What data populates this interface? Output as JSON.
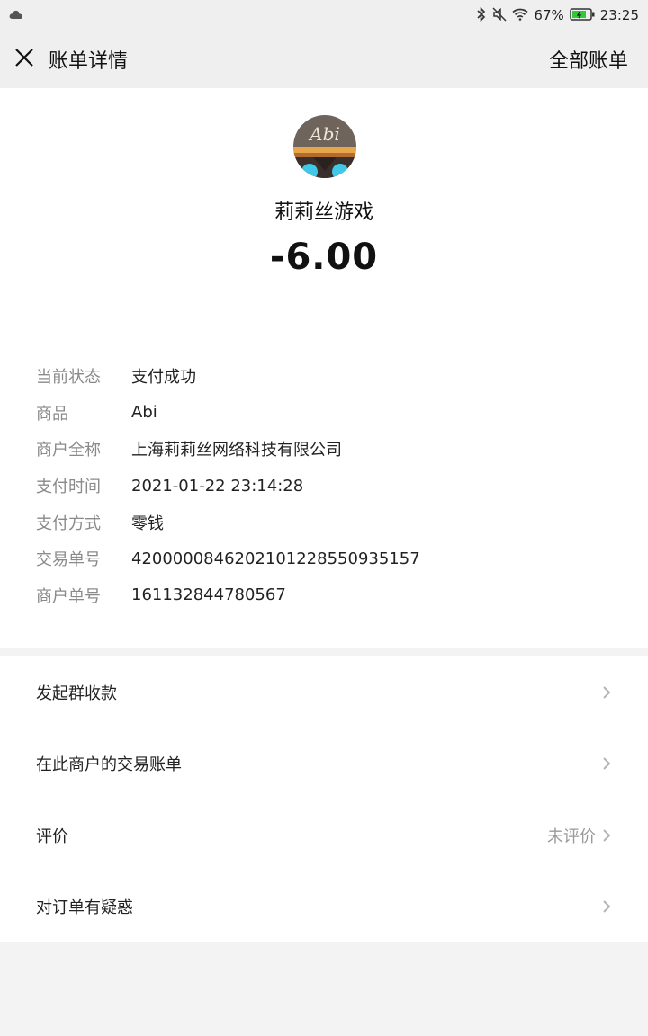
{
  "status_bar": {
    "battery_percent": "67%",
    "time": "23:25"
  },
  "header": {
    "title": "账单详情",
    "all_bills_link": "全部账单"
  },
  "transaction": {
    "merchant_name": "莉莉丝游戏",
    "amount": "-6.00",
    "avatar_text": "Abi"
  },
  "details": [
    {
      "label": "当前状态",
      "value": "支付成功"
    },
    {
      "label": "商品",
      "value": "Abi"
    },
    {
      "label": "商户全称",
      "value": "上海莉莉丝网络科技有限公司"
    },
    {
      "label": "支付时间",
      "value": "2021-01-22 23:14:28"
    },
    {
      "label": "支付方式",
      "value": "零钱"
    },
    {
      "label": "交易单号",
      "value": "4200000846202101228550935157"
    },
    {
      "label": "商户单号",
      "value": "161132844780567"
    }
  ],
  "menu": [
    {
      "label": "发起群收款",
      "extra": ""
    },
    {
      "label": "在此商户的交易账单",
      "extra": ""
    },
    {
      "label": "评价",
      "extra": "未评价"
    },
    {
      "label": "对订单有疑惑",
      "extra": ""
    }
  ],
  "colors": {
    "background": "#f3f3f3",
    "card": "#ffffff",
    "label_gray": "#8a8a8a",
    "battery_green": "#2fc93b"
  }
}
